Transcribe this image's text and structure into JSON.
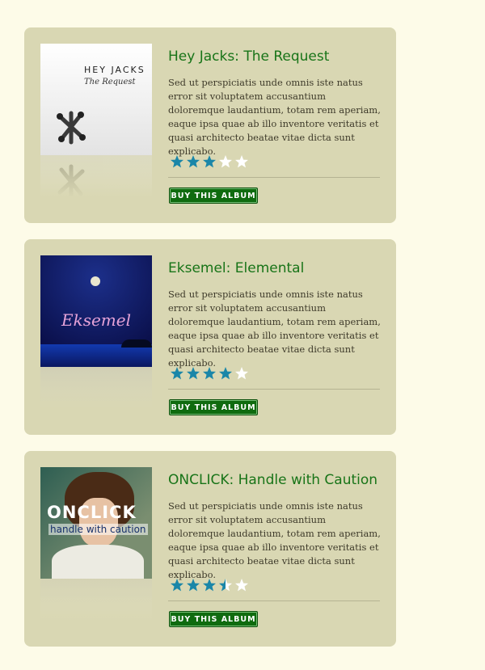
{
  "albums": [
    {
      "title": "Hey Jacks: The Request",
      "description": "Sed ut perspiciatis unde omnis iste natus error sit voluptatem accusantium doloremque laudantium, totam rem aperiam, eaque ipsa quae ab illo inventore veritatis et quasi architecto beatae vitae dicta sunt explicabo.",
      "rating": 3,
      "rating_max": 5,
      "buy_label": "BUY THIS ALBUM",
      "cover": {
        "band": "HEY JACKS",
        "album": "The Request"
      }
    },
    {
      "title": "Eksemel: Elemental",
      "description": "Sed ut perspiciatis unde omnis iste natus error sit voluptatem accusantium doloremque laudantium, totam rem aperiam, eaque ipsa quae ab illo inventore veritatis et quasi architecto beatae vitae dicta sunt explicabo.",
      "rating": 4,
      "rating_max": 5,
      "buy_label": "BUY THIS ALBUM",
      "cover": {
        "band": "Eksemel"
      }
    },
    {
      "title": "ONCLICK: Handle with Caution",
      "description": "Sed ut perspiciatis unde omnis iste natus error sit voluptatem accusantium doloremque laudantium, totam rem aperiam, eaque ipsa quae ab illo inventore veritatis et quasi architecto beatae vitae dicta sunt explicabo.",
      "rating": 3.5,
      "rating_max": 5,
      "buy_label": "BUY THIS ALBUM",
      "cover": {
        "band": "ONCLICK",
        "tagline": "handle with caution"
      }
    }
  ],
  "colors": {
    "page_background": "#fdfbe8",
    "card_background": "#d9d7b3",
    "title": "#187418",
    "star_filled": "#1a86a8",
    "star_empty": "#ffffff",
    "button": "#0f6b0f"
  },
  "icons": {
    "rating": "star-icon"
  }
}
